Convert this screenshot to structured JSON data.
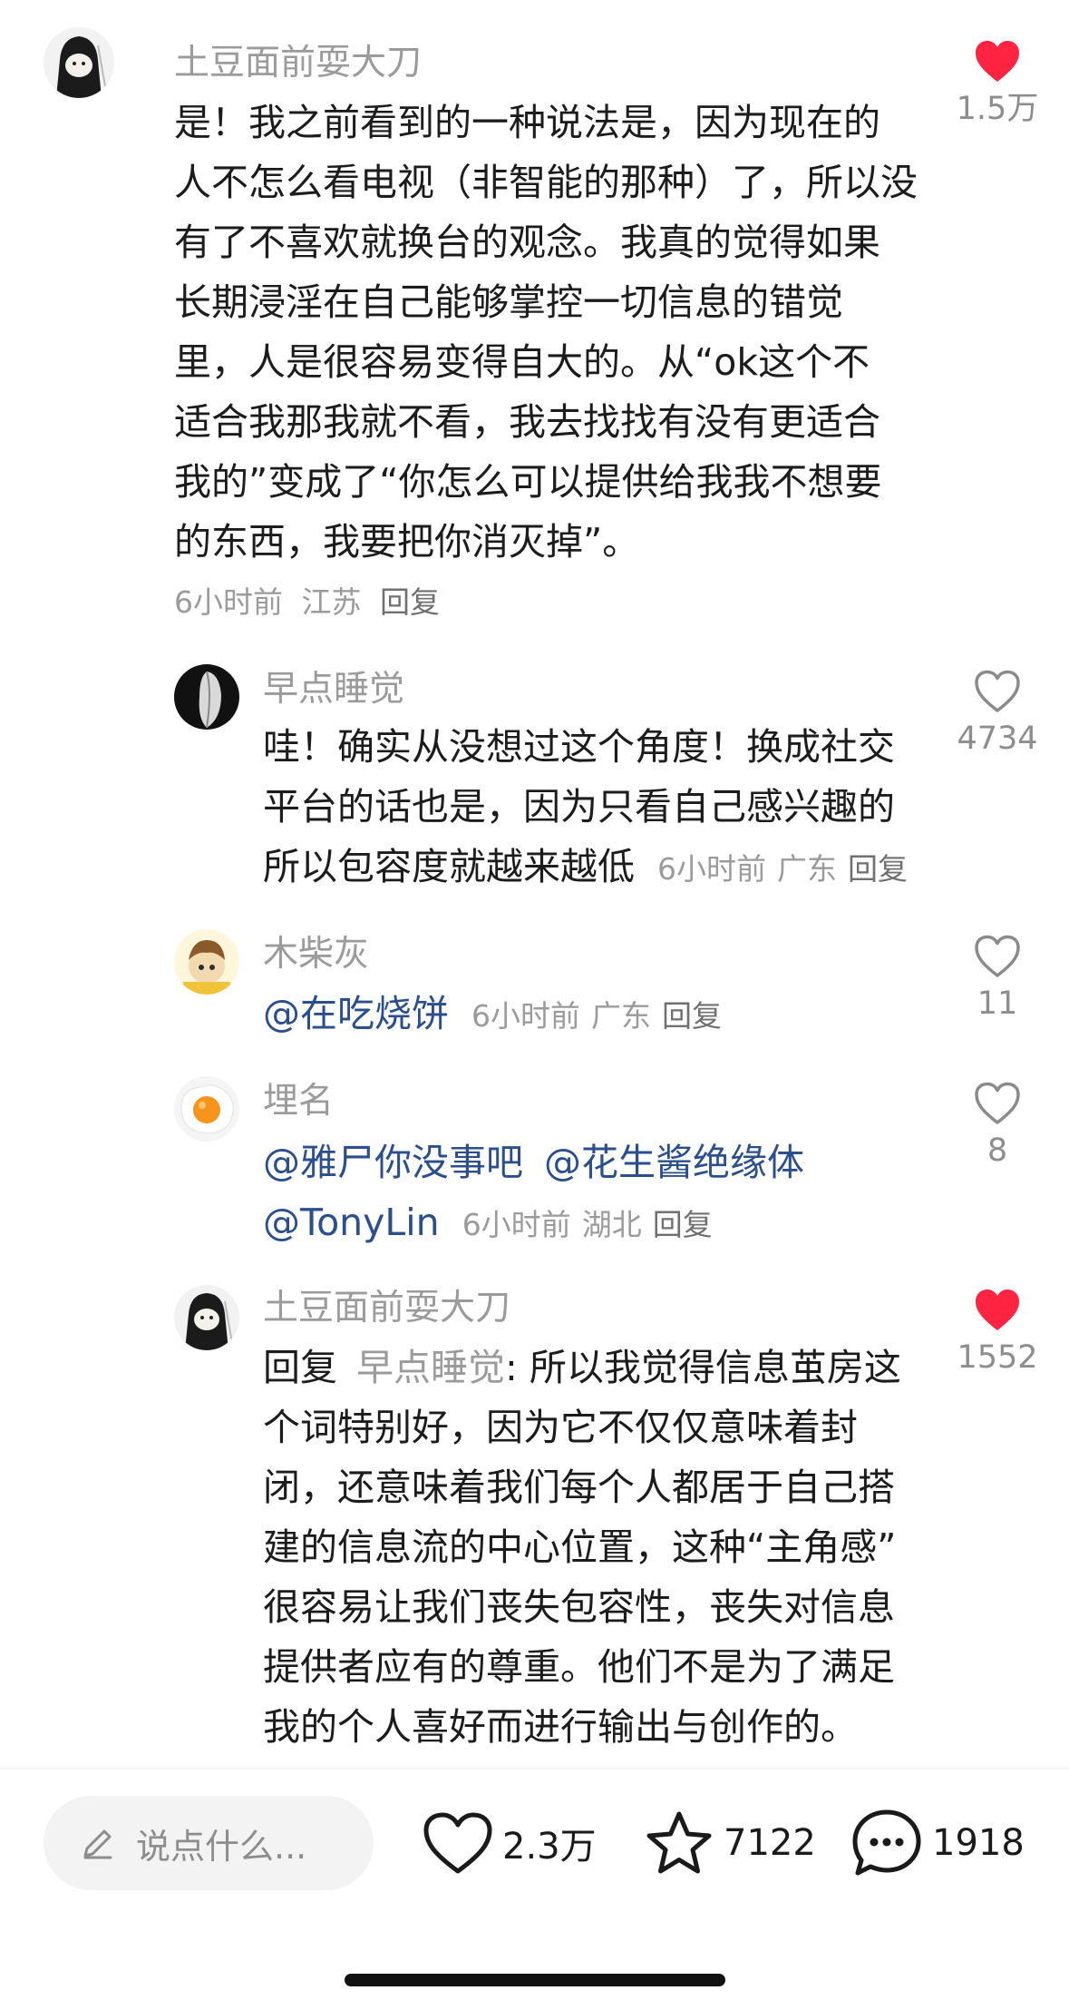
{
  "comments": {
    "c1": {
      "username": "土豆面前耍大刀",
      "lines": [
        "是！我之前看到的一种说法是，因为现在的",
        "人不怎么看电视（非智能的那种）了，所以没",
        "有了不喜欢就换台的观念。我真的觉得如果",
        "长期浸淫在自己能够掌控一切信息的错觉",
        "里，人是很容易变得自大的。从“ok这个不",
        "适合我那我就不看，我去找找有没有更适合",
        "我的”变成了“你怎么可以提供给我我不想要",
        "的东西，我要把你消灭掉”。"
      ],
      "time": "6小时前",
      "location": "江苏",
      "reply_label": "回复",
      "likes": "1.5万",
      "liked": true
    },
    "c2": {
      "username": "早点睡觉",
      "lines": [
        "哇！确实从没想过这个角度！换成社交",
        "平台的话也是，因为只看自己感兴趣的",
        "所以包容度就越来越低"
      ],
      "time": "6小时前",
      "location": "广东",
      "reply_label": "回复",
      "likes": "4734",
      "liked": false
    },
    "c3": {
      "username": "木柴灰",
      "mention": "@在吃烧饼",
      "time": "6小时前",
      "location": "广东",
      "reply_label": "回复",
      "likes": "11",
      "liked": false
    },
    "c4": {
      "username": "埋名",
      "mention1": "@雅尸你没事吧",
      "mention2": "@花生酱绝缘体",
      "mention3": "@TonyLin",
      "time": "6小时前",
      "location": "湖北",
      "reply_label": "回复",
      "likes": "8",
      "liked": false
    },
    "c5": {
      "username": "土豆面前耍大刀",
      "reply_prefix": "回复",
      "reply_to": "早点睡觉",
      "first_line_rest": ": 所以我觉得信息茧房这",
      "lines": [
        "个词特别好，因为它不仅仅意味着封",
        "闭，还意味着我们每个人都居于自己搭",
        "建的信息流的中心位置，这种“主角感”",
        "很容易让我们丧失包容性，丧失对信息",
        "提供者应有的尊重。他们不是为了满足",
        "我的个人喜好而进行输出与创作的。"
      ],
      "likes": "1552",
      "liked": true
    }
  },
  "bottom_bar": {
    "input_placeholder": "说点什么...",
    "like_count": "2.3万",
    "favorite_count": "7122",
    "comment_count": "1918"
  },
  "colors": {
    "liked_heart": "#ff2442",
    "mention": "#2b4f8c",
    "muted": "#9b9b9b"
  },
  "icons": [
    "pencil-icon",
    "heart-icon",
    "star-icon",
    "comment-bubble-icon"
  ]
}
